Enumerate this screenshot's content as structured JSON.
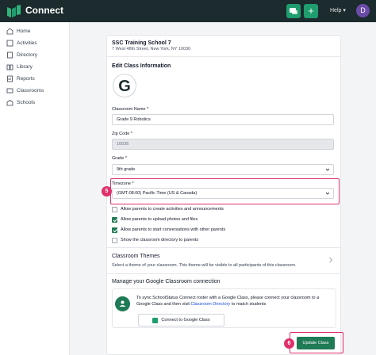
{
  "app": {
    "title": "Connect",
    "help_label": "Help",
    "avatar_initial": "D"
  },
  "sidebar": {
    "items": [
      {
        "label": "Home",
        "icon": "home-icon"
      },
      {
        "label": "Activities",
        "icon": "activities-icon"
      },
      {
        "label": "Directory",
        "icon": "directory-icon"
      },
      {
        "label": "Library",
        "icon": "library-icon"
      },
      {
        "label": "Reports",
        "icon": "reports-icon"
      },
      {
        "label": "Classrooms",
        "icon": "classrooms-icon"
      },
      {
        "label": "Schools",
        "icon": "schools-icon"
      }
    ]
  },
  "school": {
    "name": "SSC Training School 7",
    "address": "7 West 48th Street, New York, NY 10036"
  },
  "form": {
    "title": "Edit Class Information",
    "logo_letter": "G",
    "classroom_name": {
      "label": "Classroom Name *",
      "value": "Grade 9 Robotics"
    },
    "zip": {
      "label": "Zip Code *",
      "value": "10036"
    },
    "grade": {
      "label": "Grade *",
      "value": "9th grade"
    },
    "timezone": {
      "label": "Timezone *",
      "value": "(GMT-08:00) Pacific Time (US & Canada)"
    },
    "checkboxes": [
      {
        "label": "Allow parents to create activities and announcements",
        "checked": false
      },
      {
        "label": "Allow parents to upload photos and files",
        "checked": true
      },
      {
        "label": "Allow parents to start conversations with other parents",
        "checked": true
      },
      {
        "label": "Show the classroom directory to parents",
        "checked": false
      }
    ]
  },
  "themes": {
    "title": "Classroom Themes",
    "description": "Select a theme of your classroom. This theme will be visible to all participants of this classroom."
  },
  "google": {
    "title": "Manage your Google Classroom connection",
    "text_before": "To sync SchoolStatus Connect roster with a Google Class, please connect your classroom to a Google Class and then visit ",
    "link": "Classroom Directory",
    "text_after": " to match students",
    "button": "Connect to Google Class"
  },
  "update_button": "Update Class",
  "steps": {
    "timezone": "5",
    "update": "6"
  },
  "colors": {
    "accent": "#1f7a56",
    "highlight": "#e0306b",
    "topbar": "#1c2b2d"
  }
}
